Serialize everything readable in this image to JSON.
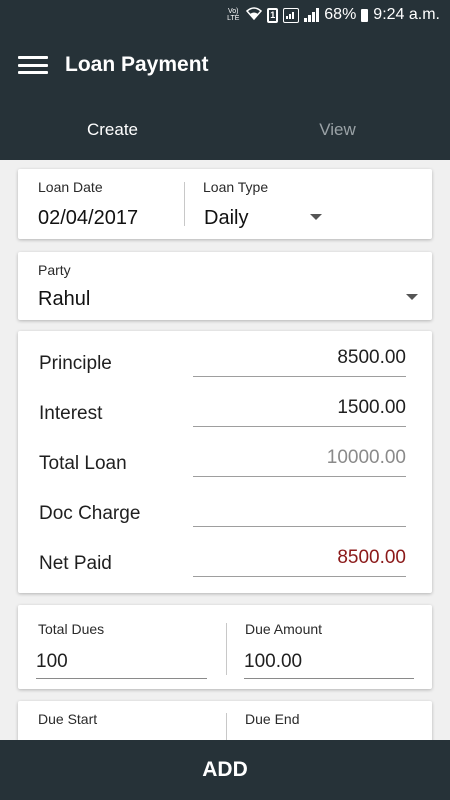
{
  "status_bar": {
    "volte": "Vo) LTE",
    "sim_label": "1",
    "battery_percent": "68%",
    "time": "9:24 a.m."
  },
  "app_bar": {
    "title": "Loan Payment"
  },
  "tabs": [
    {
      "label": "Create",
      "active": true
    },
    {
      "label": "View",
      "active": false
    }
  ],
  "loan_info": {
    "loan_date_label": "Loan Date",
    "loan_date_value": "02/04/2017",
    "loan_type_label": "Loan Type",
    "loan_type_value": "Daily"
  },
  "party": {
    "label": "Party",
    "value": "Rahul"
  },
  "amounts": {
    "principle_label": "Principle",
    "principle_value": "8500.00",
    "interest_label": "Interest",
    "interest_value": "1500.00",
    "total_loan_label": "Total Loan",
    "total_loan_value": "10000.00",
    "doc_charge_label": "Doc Charge",
    "doc_charge_value": "",
    "net_paid_label": "Net Paid",
    "net_paid_value": "8500.00"
  },
  "dues": {
    "total_dues_label": "Total Dues",
    "total_dues_value": "100",
    "due_amount_label": "Due Amount",
    "due_amount_value": "100.00"
  },
  "dates": {
    "due_start_label": "Due Start",
    "due_end_label": "Due End"
  },
  "actions": {
    "add_label": "ADD"
  },
  "colors": {
    "bar_bg": "#263238",
    "net_paid_text": "#8b1a1a",
    "total_loan_text": "#8a8a8a"
  }
}
